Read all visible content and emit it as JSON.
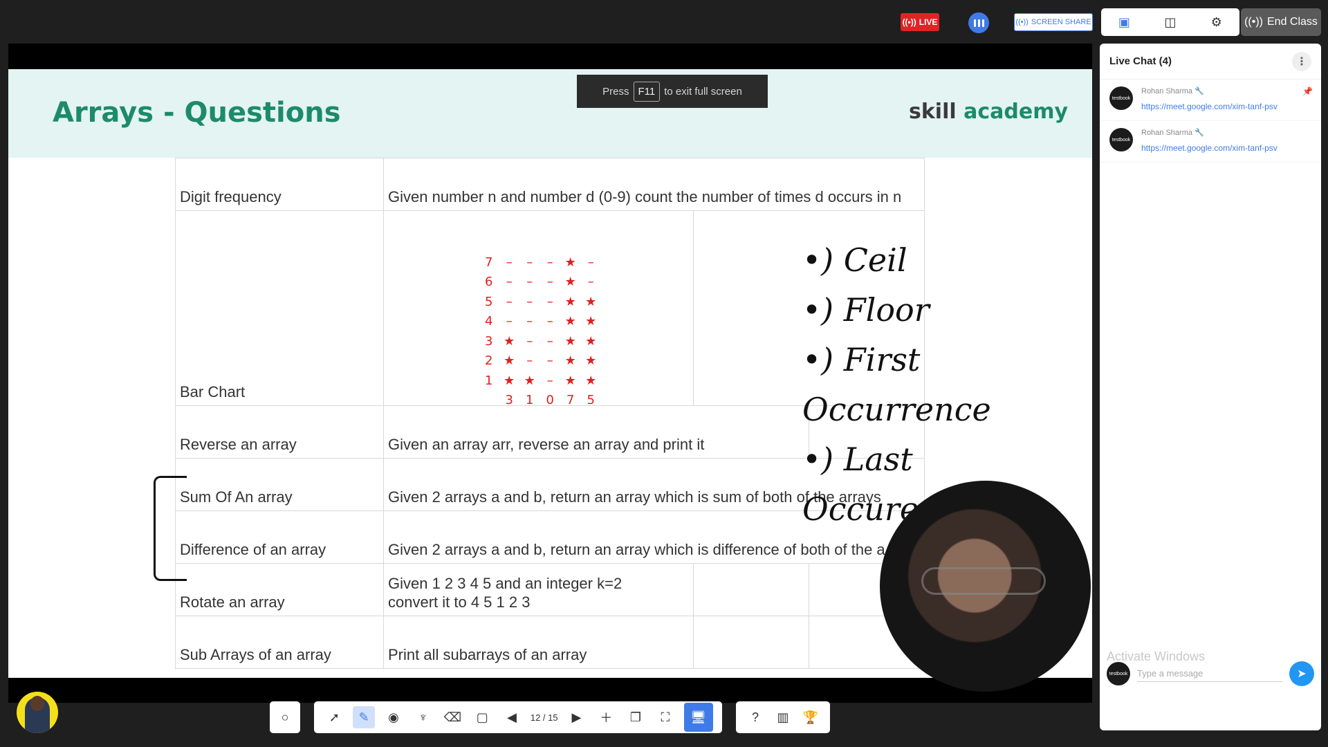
{
  "topbar": {
    "live_label": "LIVE",
    "screen_share_label": "SCREEN SHARE",
    "end_class_label": "End Class"
  },
  "fullscreen_tip": {
    "press": "Press",
    "key": "F11",
    "rest": "to exit full screen"
  },
  "slide": {
    "title": "Arrays - Questions",
    "brand_prefix": "skill",
    "brand_suffix": " academy",
    "rows": [
      {
        "name": "Digit frequency",
        "desc": "Given number n and number d (0-9) count the number of times d occurs in n"
      },
      {
        "name": "Bar Chart",
        "desc": ""
      },
      {
        "name": "Reverse an array",
        "desc": "Given an array arr, reverse an array and print it"
      },
      {
        "name": "Sum Of An array",
        "desc": "Given 2 arrays a and b, return an array which is sum of both of the arrays"
      },
      {
        "name": "Difference of an array",
        "desc": "Given 2 arrays a and b, return an array which is difference of both of the a"
      },
      {
        "name": "Rotate an array",
        "desc_line1": "Given 1 2 3 4 5 and an integer k=2",
        "desc_line2": "convert it to 4 5 1 2 3"
      },
      {
        "name": "Sub Arrays of an array",
        "desc": "Print all subarrays of an array"
      }
    ],
    "bar_grid": [
      [
        "7",
        "–",
        "–",
        "–",
        "★",
        "–"
      ],
      [
        "6",
        "–",
        "–",
        "–",
        "★",
        "–"
      ],
      [
        "5",
        "–",
        "–",
        "–",
        "★",
        "★"
      ],
      [
        "4",
        "–",
        "–",
        "–",
        "★",
        "★"
      ],
      [
        "3",
        "★",
        "–",
        "–",
        "★",
        "★"
      ],
      [
        "2",
        "★",
        "–",
        "–",
        "★",
        "★"
      ],
      [
        "1",
        "★",
        "★",
        "–",
        "★",
        "★"
      ],
      [
        "",
        "3",
        "1",
        "0",
        "7",
        "5"
      ]
    ],
    "handwriting": [
      "Ceil",
      "Floor",
      "First Occurrence",
      "Last Occurence"
    ]
  },
  "chat": {
    "title": "Live Chat (4)",
    "messages": [
      {
        "author": "Rohan Sharma",
        "link": "https://meet.google.com/xim-tanf-psv",
        "pinned": true
      },
      {
        "author": "Rohan Sharma",
        "link": "https://meet.google.com/xim-tanf-psv",
        "pinned": false
      }
    ],
    "input_placeholder": "Type a message",
    "watermark": "Activate Windows",
    "avatar_text": "testbook"
  },
  "toolbar": {
    "page_indicator": "12 / 15"
  }
}
